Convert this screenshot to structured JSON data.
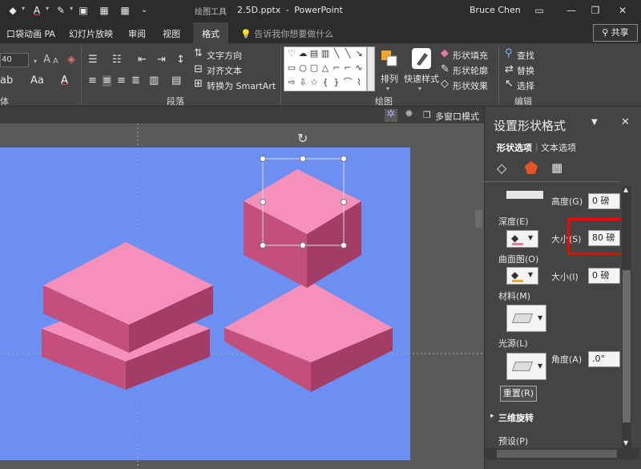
{
  "titlebar": {
    "context_tool": "绘图工具",
    "doc_name": "2.5D.pptx",
    "app_name": "PowerPoint",
    "user": "Bruce Chen",
    "min": "—",
    "restore": "❐",
    "close": "✕"
  },
  "tabs": [
    "口袋动画 PA",
    "幻灯片放映",
    "审阅",
    "视图",
    "格式"
  ],
  "tellme": "告诉我你想要做什么",
  "share": "共享",
  "ribbon": {
    "font_size": "40",
    "text_direction": "文字方向",
    "align_text": "对齐文本",
    "convert_smartart": "转换为 SmartArt",
    "arrange": "排列",
    "quick_styles": "快速样式",
    "shape_fill": "形状填充",
    "shape_outline": "形状轮廓",
    "shape_effects": "形状效果",
    "find": "查找",
    "replace": "替换",
    "select": "选择",
    "group_font": "体",
    "group_paragraph": "段落",
    "group_drawing": "绘图",
    "group_editing": "编辑"
  },
  "subtool": {
    "multiwindow": "多窗口模式"
  },
  "pane": {
    "title": "设置形状格式",
    "tab_shape": "形状选项",
    "tab_text": "文本选项",
    "height_label": "高度(G)",
    "height_value": "0 磅",
    "depth_label": "深度(E)",
    "size_label_1": "大小(S)",
    "size_value_1": "80 磅",
    "contour_label": "曲面图(O)",
    "size_label_2": "大小(I)",
    "size_value_2": "0 磅",
    "material_label": "材料(M)",
    "lighting_label": "光源(L)",
    "angle_label": "角度(A)",
    "angle_value": ".0°",
    "reset_button": "重置(R)",
    "rotation_section": "三维旋转",
    "preset_label": "预设(P)"
  },
  "colors": {
    "slide_bg": "#6d8ff2",
    "shape_top": "#f590bb",
    "shape_left": "#c24f7c",
    "shape_right": "#a33d66",
    "highlight": "#ff0000"
  }
}
